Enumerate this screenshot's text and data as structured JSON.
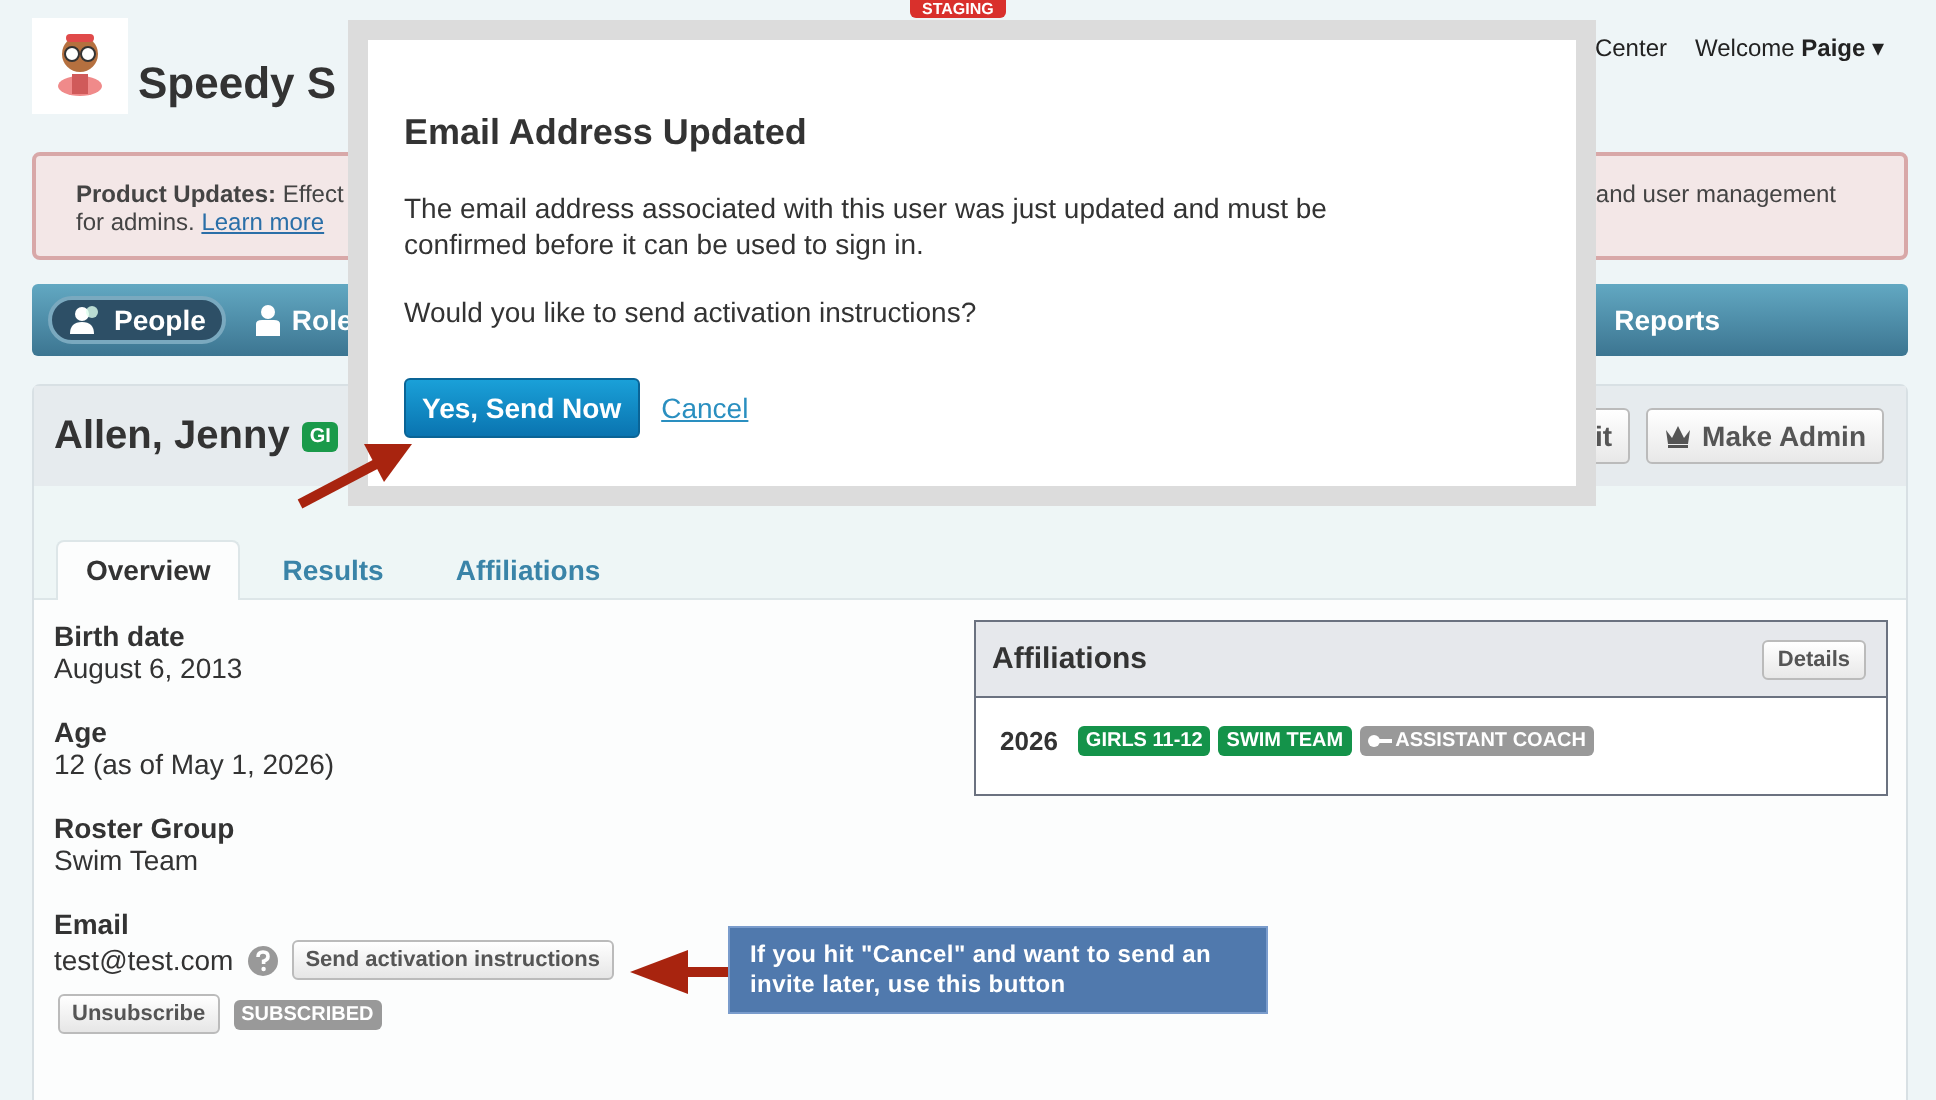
{
  "staging_badge": "STAGING",
  "header": {
    "title": "Speedy S",
    "links": [
      "Center"
    ],
    "welcome": "Welcome",
    "user": "Paige",
    "caret": "▾"
  },
  "banner": {
    "text": "**Product Updates:** Effect",
    "text_right": "and user management",
    "line2": "for admins.",
    "link": "Learn more"
  },
  "nav": [
    {
      "label": "People",
      "selected": true,
      "kind": "people"
    },
    {
      "label": "Role",
      "selected": false,
      "kind": "roles"
    },
    {
      "label": "Reports",
      "selected": false
    }
  ],
  "profile": {
    "name": "Allen, Jenny",
    "badge": "GI",
    "actions": [
      {
        "label": "it",
        "kind": "plain"
      },
      {
        "label": "Make Admin",
        "kind": "crown"
      }
    ]
  },
  "tabs": [
    {
      "label": "Overview",
      "selected": true
    },
    {
      "label": "Results",
      "selected": false
    },
    {
      "label": "Affiliations",
      "selected": false
    }
  ],
  "fields": [
    {
      "label": "Birth date",
      "value": "August 6, 2013"
    },
    {
      "label": "Age",
      "value": "12 (as of May 1, 2026)"
    },
    {
      "label": "Roster Group",
      "value": "Swim Team"
    }
  ],
  "email": {
    "label": "Email",
    "value": "test@test.com",
    "send": "Send activation instructions",
    "unsubscribe": "Unsubscribe",
    "status": "SUBSCRIBED"
  },
  "affiliations": {
    "title": "Affiliations",
    "details": "Details",
    "year": "2026",
    "tags": [
      {
        "label": "GIRLS 11-12",
        "kind": "group"
      },
      {
        "label": "SWIM TEAM",
        "kind": "group"
      },
      {
        "label": "ASSISTANT COACH",
        "kind": "role"
      }
    ]
  },
  "modal": {
    "title": "Email Address Updated",
    "message": "The email address associated with this user was just updated and must be confirmed before it can be used to sign in.",
    "question": "Would you like to send activation instructions?",
    "confirm": "Yes, Send Now",
    "cancel": "Cancel"
  },
  "callout": "If you hit \"Cancel\" and want to send an invite later, use this button"
}
